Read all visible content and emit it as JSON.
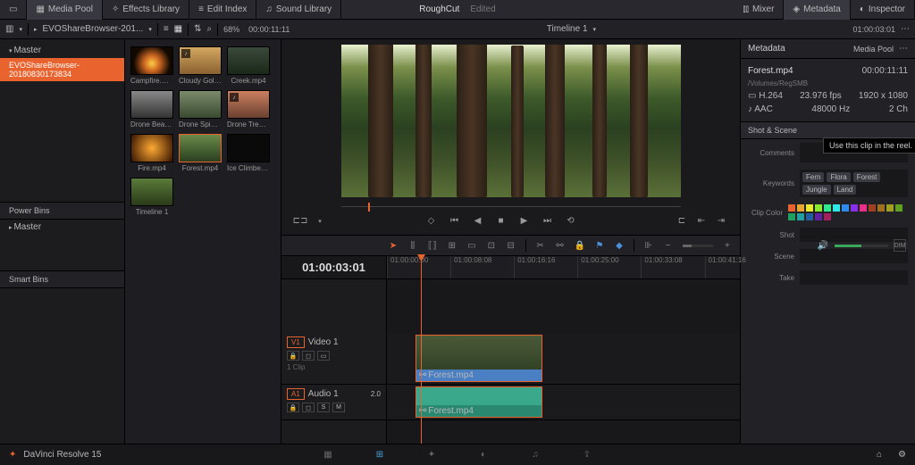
{
  "topbar": {
    "media_pool": "Media Pool",
    "effects_library": "Effects Library",
    "edit_index": "Edit Index",
    "sound_library": "Sound Library",
    "project": "RoughCut",
    "status": "Edited",
    "mixer": "Mixer",
    "metadata": "Metadata",
    "inspector": "Inspector"
  },
  "subbar": {
    "bin": "EVOShareBrowser-201...",
    "zoom": "68%",
    "tc_left": "00:00:11:11",
    "timeline_tab": "Timeline 1",
    "tc_right": "01:00:03:01"
  },
  "bins": {
    "master": "Master",
    "selected": "EVOShareBrowser-20180830173834",
    "power_bins": "Power Bins",
    "pb_master": "Master",
    "smart_bins": "Smart Bins"
  },
  "clips": [
    {
      "name": "Campfire.mp4"
    },
    {
      "name": "Cloudy Golde..."
    },
    {
      "name": "Creek.mp4"
    },
    {
      "name": "Drone Beach..."
    },
    {
      "name": "Drone Spin at..."
    },
    {
      "name": "Drone Trees a..."
    },
    {
      "name": "Fire.mp4"
    },
    {
      "name": "Forest.mp4"
    },
    {
      "name": "Ice Climber.m..."
    },
    {
      "name": "Timeline 1"
    }
  ],
  "timeline": {
    "tc": "01:00:03:01",
    "ticks": [
      "01:00:00:00",
      "01:00:08:08",
      "01:00:16:16",
      "01:00:25:00",
      "01:00:33:08",
      "01:00:41:16"
    ],
    "v1": "V1",
    "video1": "Video 1",
    "clip_count": "1 Clip",
    "a1": "A1",
    "audio1": "Audio 1",
    "a_level": "2.0",
    "clip_v": "Forest.mp4",
    "clip_a": "Forest.mp4"
  },
  "meta": {
    "title": "Metadata",
    "dropdown": "Media Pool",
    "clip": "Forest.mp4",
    "duration": "00:00:11:11",
    "path": "/Volumes/RegSMB",
    "codec_v": "H.264",
    "fps": "23.976 fps",
    "res": "1920 x 1080",
    "codec_a": "AAC",
    "rate": "48000 Hz",
    "ch": "2 Ch",
    "section": "Shot & Scene",
    "comments_lbl": "Comments",
    "tooltip": "Use this clip in the reel.",
    "keywords_lbl": "Keywords",
    "keywords": [
      "Fern",
      "Flora",
      "Forest",
      "Jungle",
      "Land"
    ],
    "clip_color_lbl": "Clip Color",
    "shot_lbl": "Shot",
    "scene_lbl": "Scene",
    "take_lbl": "Take"
  },
  "footer": {
    "app": "DaVinci Resolve 15"
  }
}
